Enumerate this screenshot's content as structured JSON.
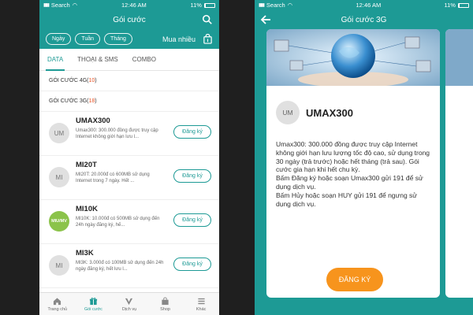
{
  "left": {
    "status": {
      "carrier": "Search",
      "time": "12:46 AM",
      "battery": "11%"
    },
    "title": "Gói cước",
    "filters": [
      "Ngày",
      "Tuần",
      "Tháng"
    ],
    "mua_nhieu": "Mua nhiều",
    "tabs": [
      "DATA",
      "THOẠI & SMS",
      "COMBO"
    ],
    "section_4g": {
      "label": "GÓI CƯỚC 4G(",
      "count": "10",
      "close": ")"
    },
    "section_3g": {
      "label": "GÓI CƯỚC 3G(",
      "count": "18",
      "close": ")"
    },
    "packages": [
      {
        "avatar": "UM",
        "name": "UMAX300",
        "desc": "Umax300: 300.000 đồng được truy cập Internet không giới hạn lưu l...",
        "button": "Đăng ký"
      },
      {
        "avatar": "MI",
        "name": "MI20T",
        "desc": "MI20T: 20.000đ có 600MB sử dụng Internet trong 7 ngày. Hết ...",
        "button": "Đăng ký"
      },
      {
        "avatar": "MIU/MV",
        "name": "MI10K",
        "desc": "MI10K: 10.000đ có 500MB sử dụng đến 24h ngày đăng ký, hế...",
        "button": "Đăng ký"
      },
      {
        "avatar": "MI",
        "name": "MI3K",
        "desc": "MI3K: 3.000đ có 100MB sử dụng đến 24h ngày đăng ký, hết lưu l...",
        "button": "Đăng ký"
      }
    ],
    "nav": [
      {
        "label": "Trang chủ",
        "icon": "home-icon"
      },
      {
        "label": "Gói cước",
        "icon": "gift-icon"
      },
      {
        "label": "Dịch vụ",
        "icon": "service-icon"
      },
      {
        "label": "Shop",
        "icon": "bag-icon"
      },
      {
        "label": "Khác",
        "icon": "menu-icon"
      }
    ]
  },
  "right": {
    "status": {
      "carrier": "Search",
      "time": "12:46 AM",
      "battery": "11%"
    },
    "title": "Gói cước 3G",
    "card": {
      "avatar": "UM",
      "name": "UMAX300",
      "lines": [
        "Umax300: 300.000 đồng được truy cập Internet không giới hạn lưu lượng tốc độ cao, sử dụng trong 30 ngày (trả trước) hoặc hết tháng (trả sau). Gói cước gia hạn khi hết chu kỳ.",
        "Bấm Đăng ký hoặc soạn Umax300 gửi 191 để sử dụng dịch vụ.",
        "Bấm Hủy hoặc soạn HUY gửi 191 để ngưng sử dụng dịch vụ."
      ],
      "button": "ĐĂNG KÝ"
    }
  },
  "colors": {
    "teal": "#1d9a95",
    "orange": "#f7941d",
    "count_red": "#e8562a"
  }
}
